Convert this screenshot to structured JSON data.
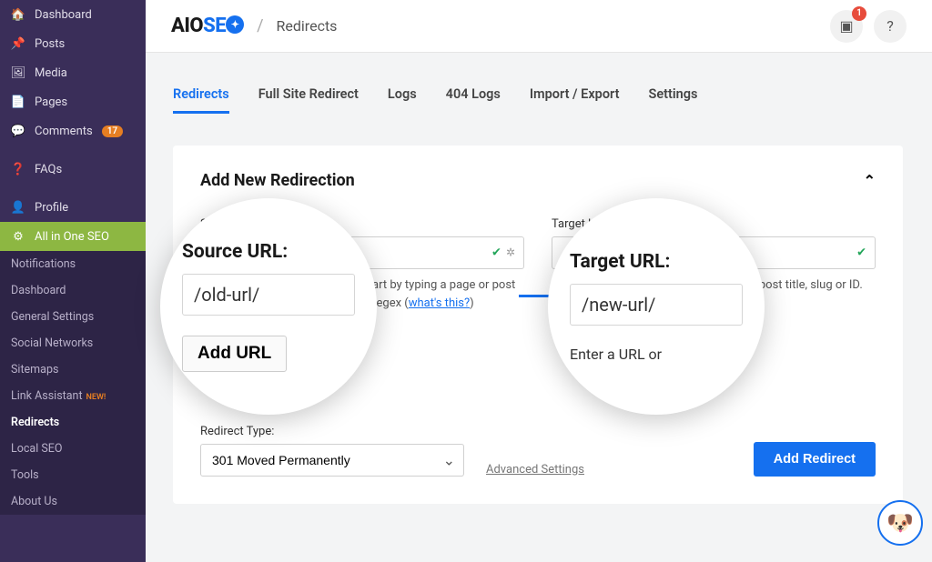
{
  "sidebar": {
    "main": [
      {
        "icon": "🏠",
        "label": "Dashboard"
      },
      {
        "icon": "📌",
        "label": "Posts"
      },
      {
        "icon": "🖼",
        "label": "Media"
      },
      {
        "icon": "📄",
        "label": "Pages"
      },
      {
        "icon": "💬",
        "label": "Comments",
        "badge": "17"
      },
      {
        "icon": "❓",
        "label": "FAQs"
      },
      {
        "icon": "👤",
        "label": "Profile"
      },
      {
        "icon": "⚙",
        "label": "All in One SEO",
        "active": true
      }
    ],
    "sub": [
      {
        "label": "Notifications",
        "dot": true
      },
      {
        "label": "Dashboard"
      },
      {
        "label": "General Settings"
      },
      {
        "label": "Social Networks"
      },
      {
        "label": "Sitemaps"
      },
      {
        "label": "Link Assistant",
        "new": "NEW!"
      },
      {
        "label": "Redirects",
        "active": true
      },
      {
        "label": "Local SEO"
      },
      {
        "label": "Tools"
      },
      {
        "label": "About Us"
      }
    ]
  },
  "topbar": {
    "logo_aio": "AIO",
    "logo_seo": "SE",
    "breadcrumb": "Redirects",
    "notif_count": "1"
  },
  "tabs": [
    {
      "label": "Redirects",
      "active": true
    },
    {
      "label": "Full Site Redirect"
    },
    {
      "label": "Logs"
    },
    {
      "label": "404 Logs"
    },
    {
      "label": "Import / Export"
    },
    {
      "label": "Settings"
    }
  ],
  "panel": {
    "title": "Add New Redirection",
    "source_label": "Source URL:",
    "source_placeholder": "/old-url/",
    "source_help_pre": "Enter a URL to redirect from or start by typing a page or post title, slug or ID. You can also use regex (",
    "source_help_link": "what's this?",
    "source_help_post": ")",
    "add_url": "Add URL",
    "target_label": "Target URL:",
    "target_placeholder": "/new-url/",
    "target_help": "Enter a URL or start by typing a page or post title, slug or ID.",
    "redirect_type_label": "Redirect Type:",
    "redirect_type_value": "301 Moved Permanently",
    "advanced": "Advanced Settings",
    "add_redirect": "Add Redirect"
  },
  "bubble1": {
    "label": "Source URL:",
    "value": "/old-url/",
    "button": "Add URL"
  },
  "bubble2": {
    "label": "Target URL:",
    "value": "/new-url/",
    "helper": "Enter a URL or"
  }
}
